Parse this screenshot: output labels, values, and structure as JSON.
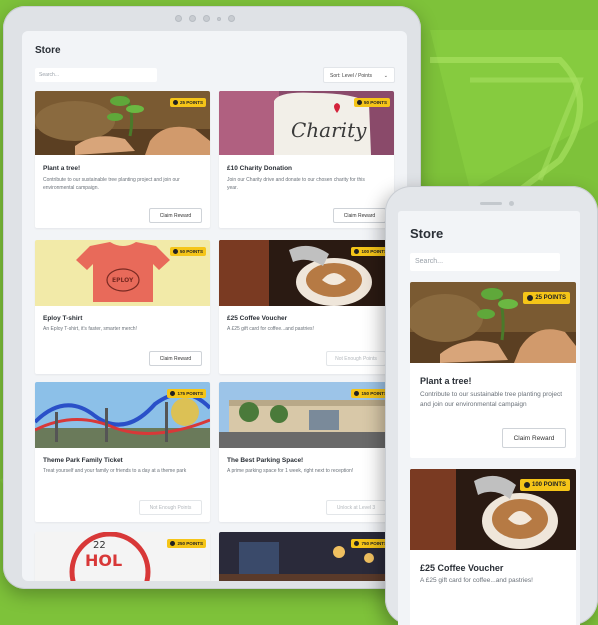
{
  "colors": {
    "background": "#7ec23a",
    "badge": "#f5c518",
    "screen": "#f2f4f7"
  },
  "tablet": {
    "title": "Store",
    "search_placeholder": "Search...",
    "sort_label": "Sort: Level / Points",
    "cards": [
      {
        "badge": "25 POINTS",
        "title": "Plant a tree!",
        "desc": "Contribute to our sustainable tree planting project and join our environmental campaign.",
        "button": "Claim Reward",
        "button_enabled": true
      },
      {
        "badge": "50 POINTS",
        "title": "£10 Charity Donation",
        "desc": "Join our Charity drive and donate to our chosen charity for this year.",
        "button": "Claim Reward",
        "button_enabled": true
      },
      {
        "badge": "50 POINTS",
        "title": "Eploy T-shirt",
        "desc": "An Eploy T-shirt, it's faster, smarter merch!",
        "button": "Claim Reward",
        "button_enabled": true
      },
      {
        "badge": "100 POINTS",
        "title": "£25 Coffee Voucher",
        "desc": "A £25 gift card for coffee...and pastries!",
        "button": "Not Enough Points",
        "button_enabled": false
      },
      {
        "badge": "175 POINTS",
        "title": "Theme Park Family Ticket",
        "desc": "Treat yourself and your family or friends to a day at a theme park",
        "button": "Not Enough Points",
        "button_enabled": false
      },
      {
        "badge": "150 POINTS",
        "title": "The Best Parking Space!",
        "desc": "A prime parking space for 1 week, right next to reception!",
        "button": "Unlock at Level 3",
        "button_enabled": false
      },
      {
        "badge": "250 POINTS"
      },
      {
        "badge": "750 POINTS"
      }
    ],
    "tshirt_text": "EPLOY"
  },
  "phone": {
    "title": "Store",
    "search_placeholder": "Search...",
    "cards": [
      {
        "badge": "25 POINTS",
        "title": "Plant a tree!",
        "desc": "Contribute to our sustainable tree planting project and join our environmental campaign",
        "button": "Claim Reward"
      },
      {
        "badge": "100 POINTS",
        "title": "£25 Coffee Voucher",
        "desc": "A £25 gift card for coffee...and pastries!"
      }
    ]
  },
  "icons": [
    "chevron-down-icon",
    "coin-icon"
  ]
}
